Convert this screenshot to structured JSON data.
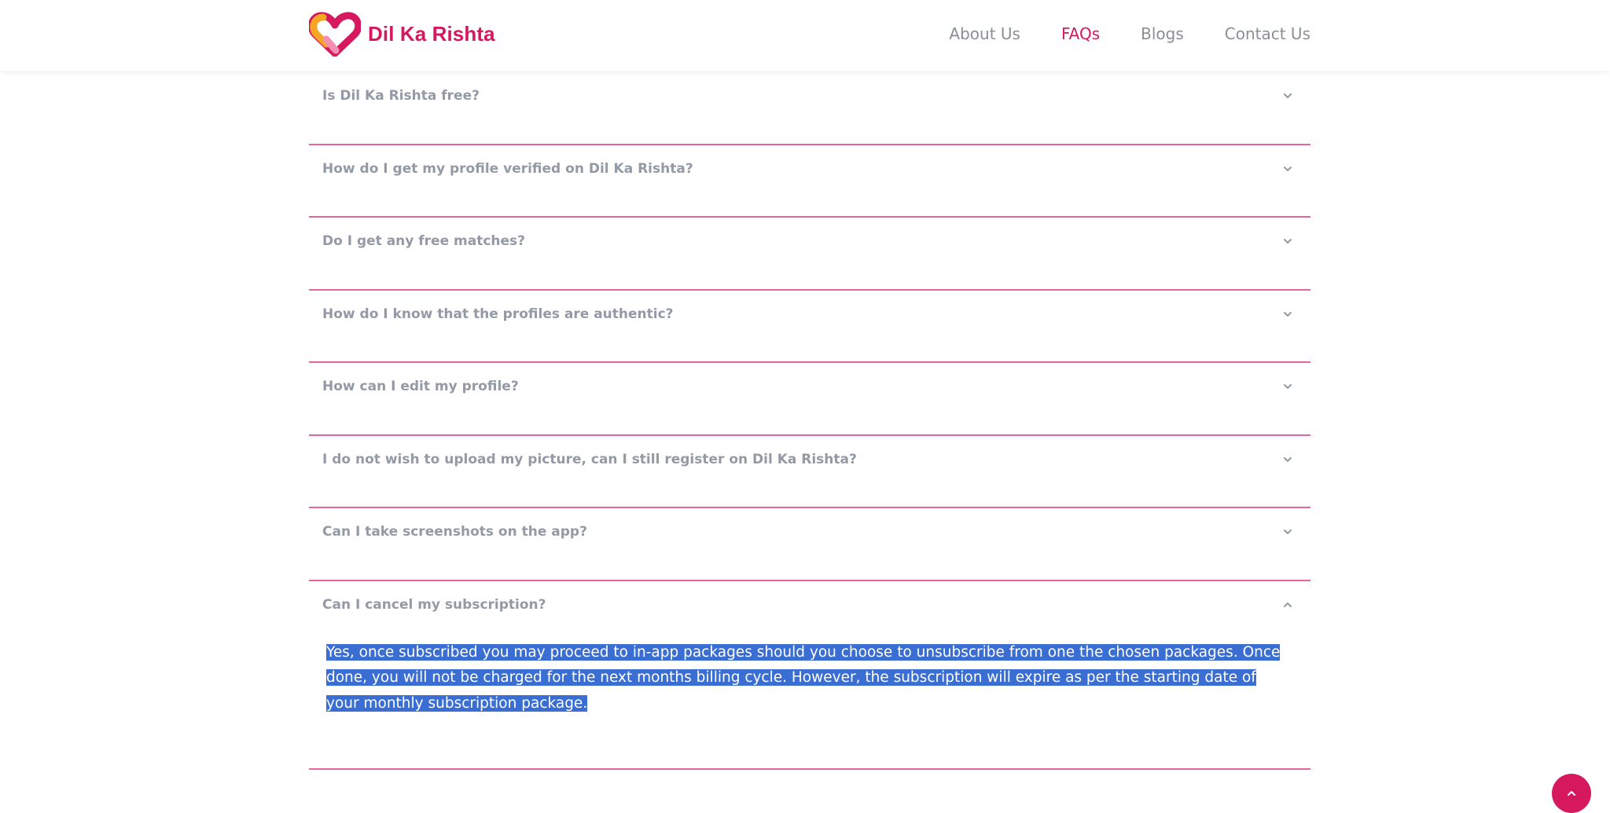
{
  "brand": {
    "name": "Dil Ka Rishta",
    "accent_color": "#d6185f",
    "logo_icon": "heart-logo-icon"
  },
  "nav": {
    "items": [
      {
        "label": "About Us",
        "active": false
      },
      {
        "label": "FAQs",
        "active": true
      },
      {
        "label": "Blogs",
        "active": false
      },
      {
        "label": "Contact Us",
        "active": false
      }
    ]
  },
  "faqs": [
    {
      "question": "Is Dil Ka Rishta free?",
      "expanded": false
    },
    {
      "question": "How do I get my profile verified on Dil Ka Rishta?",
      "expanded": false
    },
    {
      "question": "Do I get any free matches?",
      "expanded": false
    },
    {
      "question": "How do I know that the profiles are authentic?",
      "expanded": false
    },
    {
      "question": "How can I edit my profile?",
      "expanded": false
    },
    {
      "question": "I do not wish to upload my picture, can I still register on Dil Ka Rishta?",
      "expanded": false
    },
    {
      "question": "Can I take screenshots on the app?",
      "expanded": false
    },
    {
      "question": "Can I cancel my subscription?",
      "expanded": true,
      "answer": "Yes, once subscribed you may proceed to in-app packages should you choose to unsubscribe from one the chosen packages. Once done, you will not be charged for the next months billing cycle. However, the subscription will expire as per the starting date of your monthly subscription package."
    }
  ],
  "icons": {
    "collapsed": "chevron-down-icon",
    "expanded": "chevron-up-icon",
    "scroll_top": "chevron-up-icon"
  }
}
